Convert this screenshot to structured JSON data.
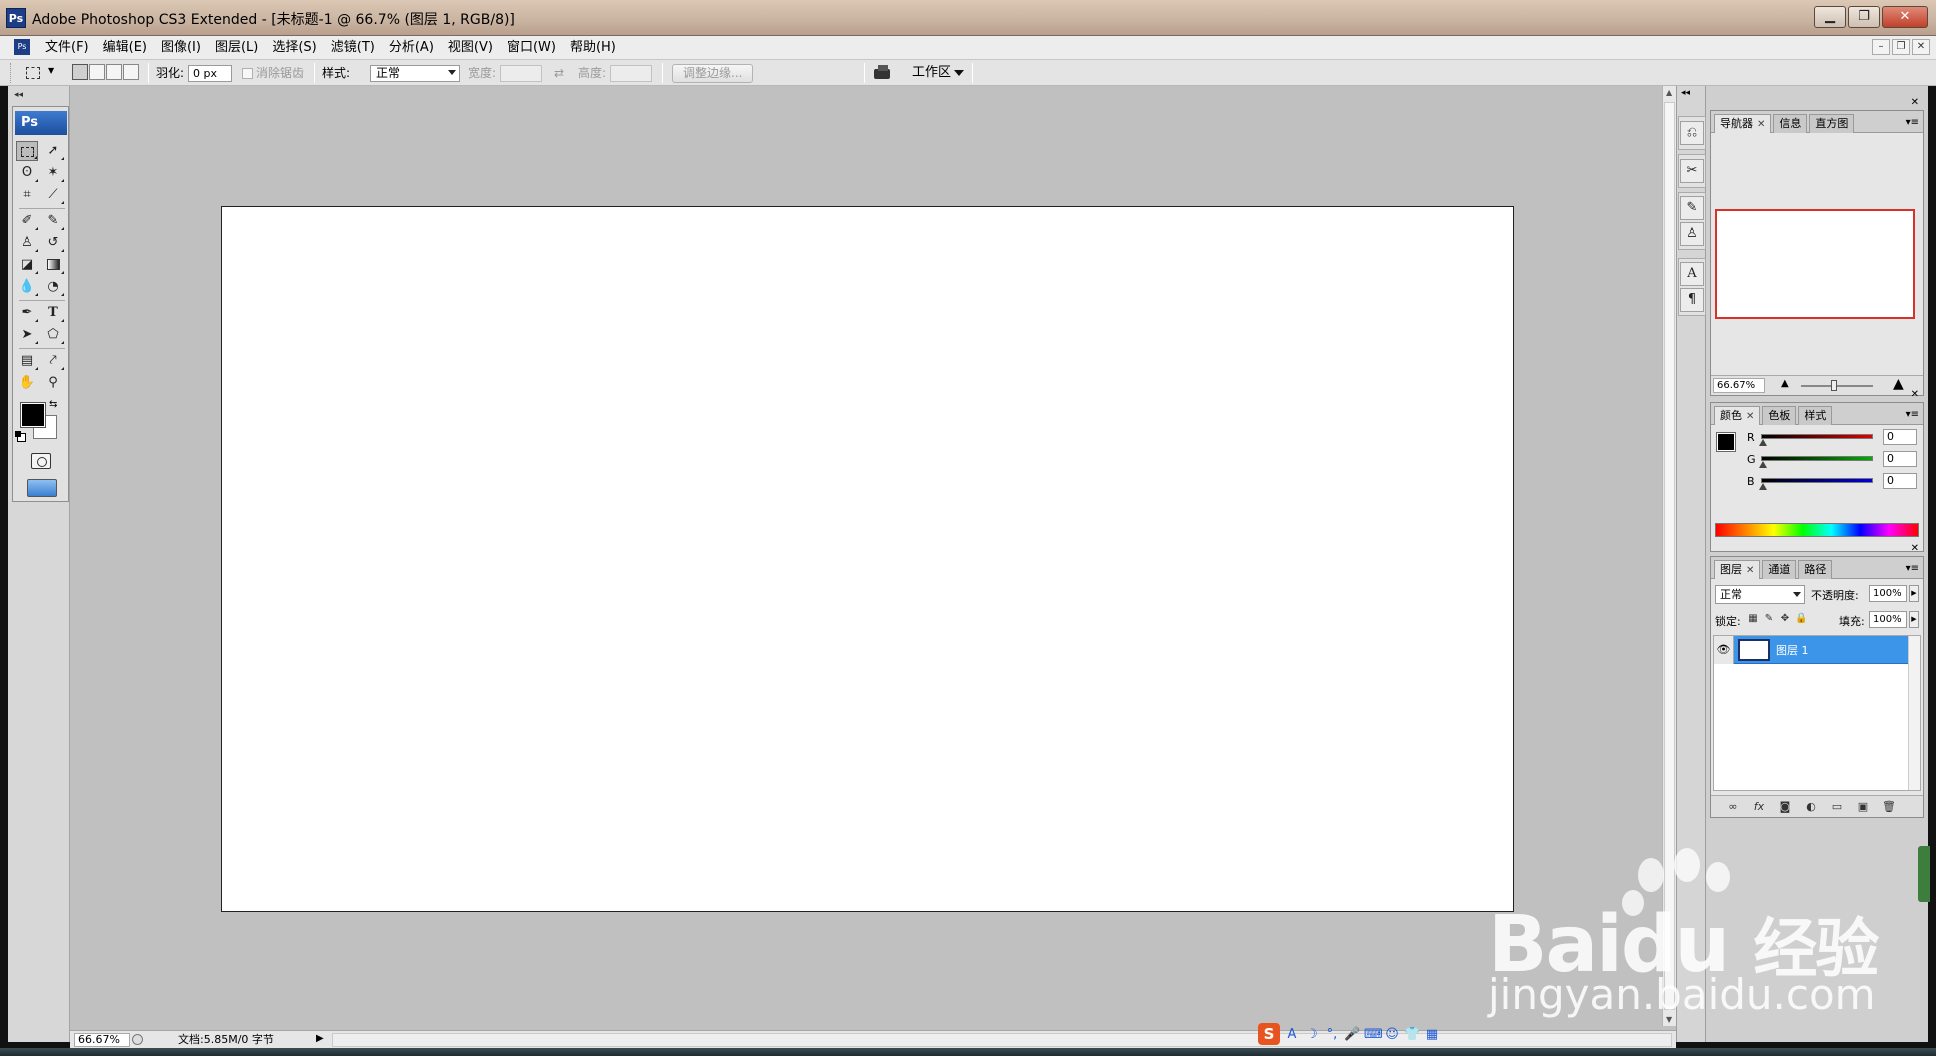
{
  "window": {
    "title": "Adobe Photoshop CS3 Extended - [未标题-1 @ 66.7% (图层 1, RGB/8)]",
    "app_icon": "Ps",
    "controls": [
      "minimize-icon",
      "maximize-icon",
      "close-icon"
    ]
  },
  "menubar": {
    "items": [
      "文件(F)",
      "编辑(E)",
      "图像(I)",
      "图层(L)",
      "选择(S)",
      "滤镜(T)",
      "分析(A)",
      "视图(V)",
      "窗口(W)",
      "帮助(H)"
    ]
  },
  "options": {
    "feather_label": "羽化:",
    "feather_value": "0 px",
    "antialias_label": "消除锯齿",
    "style_label": "样式:",
    "style_value": "正常",
    "width_label": "宽度:",
    "height_label": "高度:",
    "refine_edge": "调整边缘...",
    "workspace": "工作区"
  },
  "toolbox": {
    "logo": "Ps",
    "foreground_color": "#000000",
    "background_color": "#ffffff"
  },
  "document": {
    "canvas_color": "#ffffff"
  },
  "statusbar": {
    "zoom": "66.67%",
    "doc_info": "文档:5.85M/0 字节"
  },
  "navigator": {
    "tabs": [
      "导航器",
      "信息",
      "直方图"
    ],
    "zoom": "66.67%",
    "view_box_color": "#d9302a"
  },
  "color": {
    "tabs": [
      "颜色",
      "色板",
      "样式"
    ],
    "channels": [
      {
        "label": "R",
        "value": "0",
        "color": "#e00000"
      },
      {
        "label": "G",
        "value": "0",
        "color": "#00b000"
      },
      {
        "label": "B",
        "value": "0",
        "color": "#0000e0"
      }
    ]
  },
  "layers": {
    "tabs": [
      "图层",
      "通道",
      "路径"
    ],
    "blend_mode": "正常",
    "opacity_label": "不透明度:",
    "opacity": "100%",
    "lock_label": "锁定:",
    "fill_label": "填充:",
    "fill": "100%",
    "items": [
      {
        "name": "图层 1",
        "visible": true,
        "selected": true
      }
    ],
    "footer_icons": [
      "link-icon",
      "fx-icon",
      "mask-icon",
      "adjustment-icon",
      "group-icon",
      "new-layer-icon",
      "trash-icon"
    ]
  },
  "watermark": {
    "brand": "Bai",
    "brand2": "经验",
    "url": "jingyan.baidu.com"
  }
}
